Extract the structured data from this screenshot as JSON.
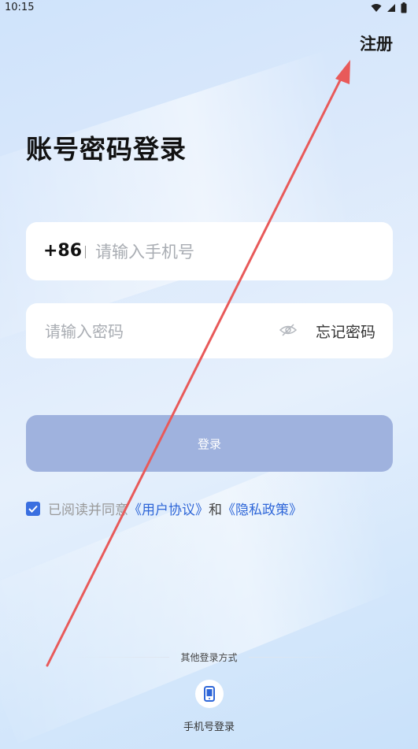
{
  "status_bar": {
    "time": "10:15"
  },
  "header": {
    "register_label": "注册"
  },
  "page": {
    "title": "账号密码登录"
  },
  "phone": {
    "country_code": "+86",
    "placeholder": "请输入手机号"
  },
  "password": {
    "placeholder": "请输入密码",
    "forgot_label": "忘记密码",
    "visibility_icon": "eye-off-icon"
  },
  "login": {
    "label": "登录",
    "color": "#9fb2de"
  },
  "agreement": {
    "checked": true,
    "prefix": "已阅读并同意",
    "user_agreement": "《用户协议》",
    "and": "和",
    "privacy_policy": "《隐私政策》",
    "link_color": "#2e66d8"
  },
  "other_login": {
    "title": "其他登录方式",
    "phone_login_label": "手机号登录",
    "phone_login_icon": "phone-icon"
  },
  "annotation": {
    "arrow_color": "#e85a5a"
  }
}
